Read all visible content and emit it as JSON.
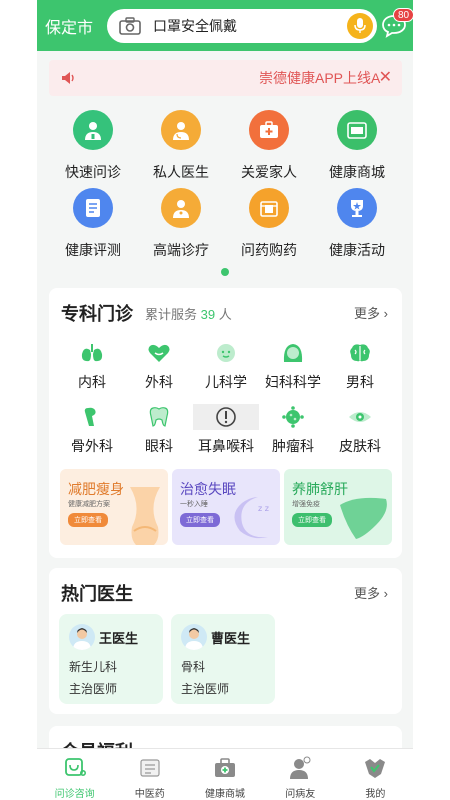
{
  "header": {
    "city": "保定市",
    "search_placeholder": "口罩安全佩戴",
    "message_badge": "80"
  },
  "notice": {
    "text": "崇德健康APP上线A",
    "close_symbol": "✕"
  },
  "entries": [
    {
      "label": "快速问诊",
      "color": "#35c27b",
      "icon": "doctor-icon"
    },
    {
      "label": "私人医生",
      "color": "#f5ab37",
      "icon": "private-doctor-icon"
    },
    {
      "label": "关爱家人",
      "color": "#f2703c",
      "icon": "medkit-icon"
    },
    {
      "label": "健康商城",
      "color": "#3bbf6a",
      "icon": "store-icon"
    },
    {
      "label": "健康评测",
      "color": "#4f86ee",
      "icon": "clipboard-icon"
    },
    {
      "label": "高端诊疗",
      "color": "#f5ab37",
      "icon": "specialist-icon"
    },
    {
      "label": "问药购药",
      "color": "#f5a22b",
      "icon": "medicine-icon"
    },
    {
      "label": "健康活动",
      "color": "#4f86ee",
      "icon": "trophy-icon"
    }
  ],
  "specialty": {
    "title": "专科门诊",
    "served_label": "累计服务",
    "served_count": "39",
    "served_unit": "人",
    "more": "更多",
    "departments": [
      {
        "label": "内科",
        "icon": "lungs-icon"
      },
      {
        "label": "外科",
        "icon": "heart-icon"
      },
      {
        "label": "儿科学",
        "icon": "baby-icon"
      },
      {
        "label": "妇科科学",
        "icon": "woman-icon"
      },
      {
        "label": "男科",
        "icon": "brain-icon"
      },
      {
        "label": "骨外科",
        "icon": "bone-icon"
      },
      {
        "label": "眼科",
        "icon": "tooth-icon"
      },
      {
        "label": "耳鼻喉科",
        "icon": "alert-icon"
      },
      {
        "label": "肿瘤科",
        "icon": "virus-icon"
      },
      {
        "label": "皮肤科",
        "icon": "eye-icon"
      }
    ],
    "banners": [
      {
        "title": "减肥瘦身",
        "sub": "健康减肥方案",
        "button": "立即查看",
        "bg": "#fdeee0",
        "accent": "#f08a3a"
      },
      {
        "title": "治愈失眠",
        "sub": "一秒入睡",
        "button": "立即查看",
        "bg": "#e8e5fb",
        "accent": "#7d6ad6"
      },
      {
        "title": "养肺舒肝",
        "sub": "增强免疫",
        "button": "立即查看",
        "bg": "#def6e7",
        "accent": "#3dbf6e"
      }
    ]
  },
  "hot_doctors": {
    "title": "热门医生",
    "more": "更多",
    "doctors": [
      {
        "name": "王医生",
        "dept": "新生儿科",
        "title": "主治医师"
      },
      {
        "name": "曹医生",
        "dept": "骨科",
        "title": "主治医师"
      }
    ]
  },
  "member": {
    "title": "会员福利"
  },
  "tabs": [
    {
      "label": "问诊咨询",
      "icon": "stethoscope-icon",
      "active": true
    },
    {
      "label": "中医药",
      "icon": "chinese-medicine-icon",
      "active": false
    },
    {
      "label": "健康商城",
      "icon": "medical-kit-icon",
      "active": false
    },
    {
      "label": "问病友",
      "icon": "patient-icon",
      "active": false
    },
    {
      "label": "我的",
      "icon": "profile-icon",
      "active": false
    }
  ],
  "colors": {
    "brand": "#3dc56e",
    "notice": "#e05555"
  }
}
